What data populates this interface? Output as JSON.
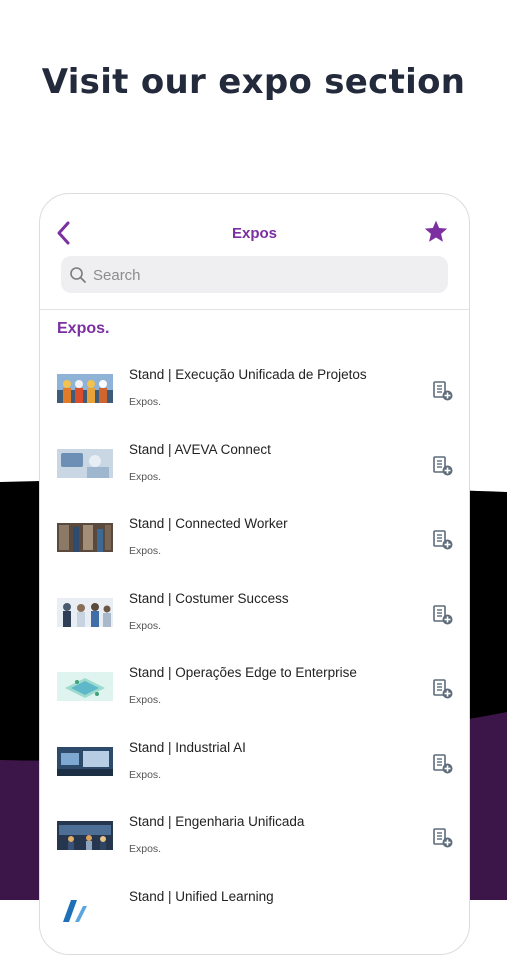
{
  "headline": "Visit our expo section",
  "appbar": {
    "title": "Expos"
  },
  "search": {
    "placeholder": "Search",
    "value": ""
  },
  "section_title": "Expos.",
  "colors": {
    "accent": "#7b2fa0",
    "dark_band": "#000000",
    "purple_band": "#3d1649",
    "icon_gray": "#5e6b7a"
  },
  "items": [
    {
      "title": "Stand | Execução Unificada de Projetos",
      "subtitle": "Expos."
    },
    {
      "title": "Stand | AVEVA Connect",
      "subtitle": "Expos."
    },
    {
      "title": "Stand | Connected Worker",
      "subtitle": "Expos."
    },
    {
      "title": "Stand | Costumer Success",
      "subtitle": "Expos."
    },
    {
      "title": "Stand | Operações Edge to Enterprise",
      "subtitle": "Expos."
    },
    {
      "title": "Stand | Industrial AI",
      "subtitle": "Expos."
    },
    {
      "title": "Stand | Engenharia Unificada",
      "subtitle": "Expos."
    },
    {
      "title": "Stand | Unified Learning",
      "subtitle": ""
    }
  ]
}
